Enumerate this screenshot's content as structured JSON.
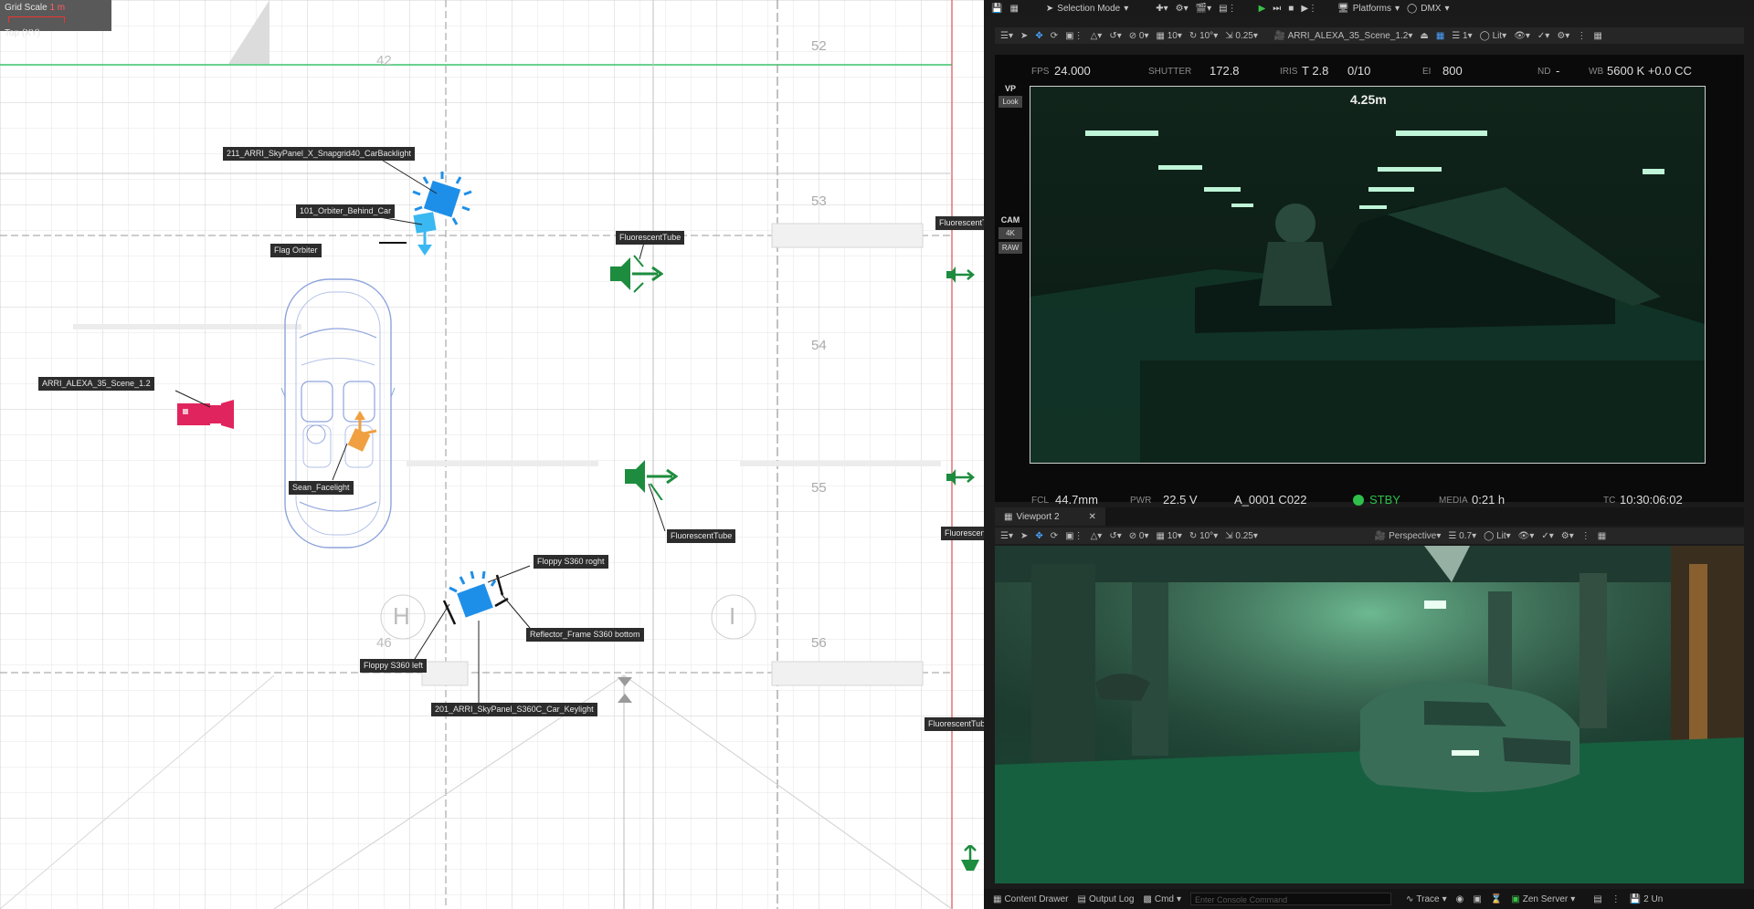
{
  "top_view": {
    "grid_scale_label": "Grid Scale",
    "grid_scale_value": "1 m",
    "view_mode": "Top (XY)",
    "grid_numbers": [
      "52",
      "53",
      "54",
      "55",
      "56",
      "42",
      "46"
    ],
    "zone_letters": [
      "H",
      "I"
    ],
    "actors": {
      "skypanel_backlight": "211_ARRI_SkyPanel_X_Snapgrid40_CarBacklight",
      "orbiter_behind_car": "101_Orbiter_Behind_Car",
      "flag_orbiter": "Flag Orbiter",
      "fluorescent_tube_1": "FluorescentTube",
      "fluorescent_tube_2": "FluorescentTube",
      "fluorescent_tube_edge_1": "FluorescentT",
      "fluorescent_tube_edge_2": "Fluorescent",
      "fluorescent_tube_edge_3": "FluorescentTube",
      "camera_actor": "ARRI_ALEXA_35_Scene_1.2",
      "sean_facelight": "Sean_Facelight",
      "floppy_right": "Floppy S360 roght",
      "reflector_frame": "Reflector_Frame S360 bottom",
      "floppy_left": "Floppy S360 left",
      "skypanel_keylight": "201_ARRI_SkyPanel_S360C_Car_Keylight"
    }
  },
  "main_toolbar": {
    "mode": "Selection Mode",
    "platforms": "Platforms",
    "dmx": "DMX"
  },
  "viewport1_toolbar": {
    "snap_rotate": "0",
    "grid_snap": "10",
    "rot_snap": "10°",
    "scale_snap": "0.25",
    "camera": "ARRI_ALEXA_35_Scene_1.2",
    "layers": "1",
    "lit": "Lit"
  },
  "camera_hud": {
    "vp": "VP",
    "look": "Look",
    "cam": "CAM",
    "res": "4K",
    "raw": "RAW",
    "fps_label": "FPS",
    "fps": "24.000",
    "shutter_label": "SHUTTER",
    "shutter": "172.8",
    "iris_label": "IRIS",
    "iris": "T 2.8",
    "iris_fraction": "0/10",
    "ei_label": "EI",
    "ei": "800",
    "nd_label": "ND",
    "nd": "-",
    "wb_label": "WB",
    "wb": "5600 K +0.0 CC",
    "distance": "4.25m",
    "fcl_label": "FCL",
    "fcl": "44.7mm",
    "pwr_label": "PWR",
    "pwr": "22.5 V",
    "clip": "A_0001 C022",
    "status": "STBY",
    "media_label": "MEDIA",
    "media": "0:21 h",
    "tc_label": "TC",
    "tc": "10:30:06:02"
  },
  "viewport2": {
    "tab": "Viewport 2",
    "perspective": "Perspective",
    "fov": "0.7",
    "lit": "Lit",
    "snap_rotate": "0",
    "grid_snap": "10",
    "rot_snap": "10°",
    "scale_snap": "0.25"
  },
  "status_bar": {
    "content_drawer": "Content Drawer",
    "output_log": "Output Log",
    "cmd": "Cmd",
    "console_placeholder": "Enter Console Command",
    "trace": "Trace",
    "zen_server": "Zen Server",
    "unsaved": "2 Un"
  },
  "colors": {
    "camera_red": "#e0245e",
    "light_blue": "#1e8fe8",
    "tube_green": "#1d8c3e",
    "record_green": "#2ec04b",
    "accent_orange": "#f0a040"
  }
}
